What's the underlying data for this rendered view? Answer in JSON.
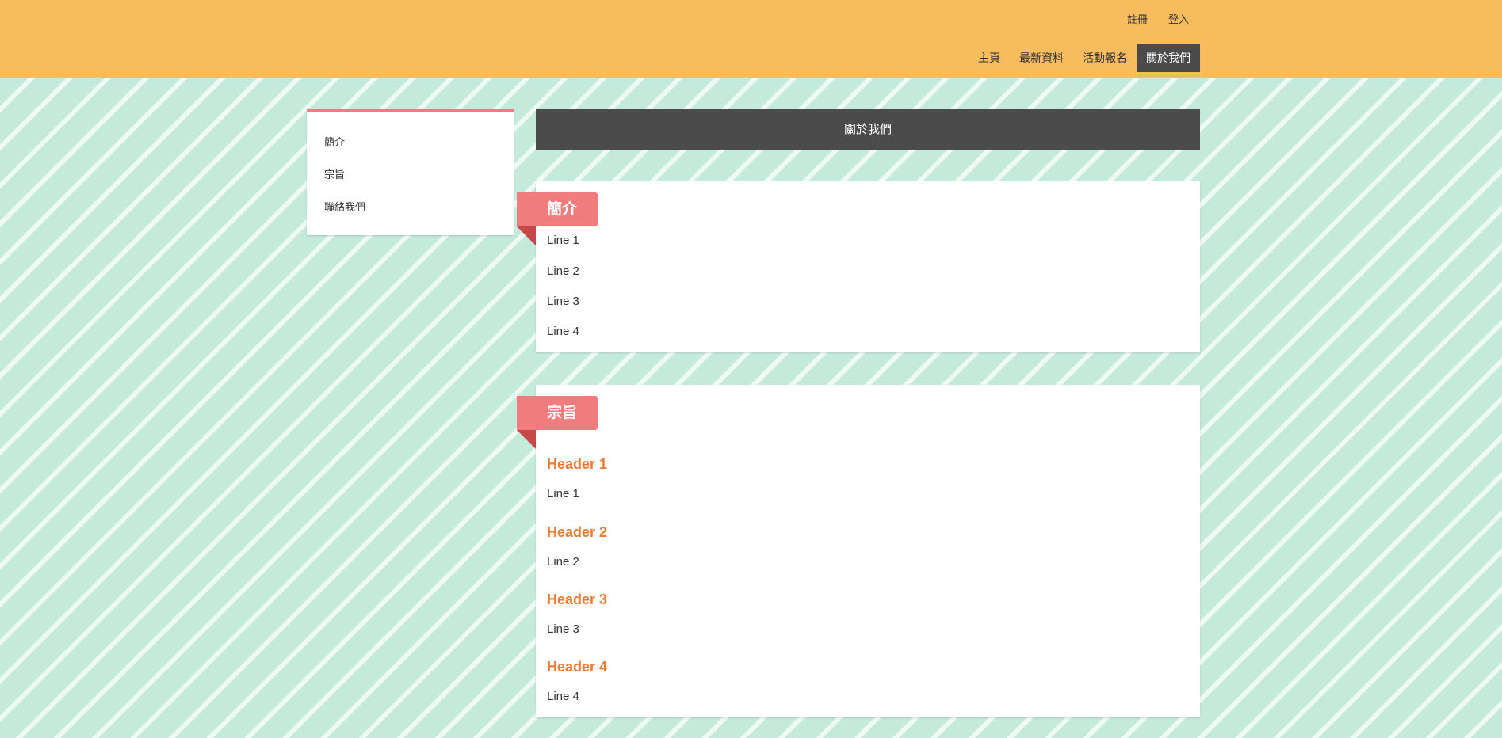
{
  "header": {
    "top_links": [
      "註冊",
      "登入"
    ],
    "nav": {
      "items": [
        "主頁",
        "最新資料",
        "活動報名",
        "關於我們"
      ],
      "active": "關於我們"
    }
  },
  "sidebar": {
    "items": [
      "簡介",
      "宗旨",
      "聯絡我們"
    ]
  },
  "page_title": "關於我們",
  "sections": [
    {
      "title": "簡介",
      "lines": [
        "Line 1",
        "Line 2",
        "Line 3",
        "Line 4"
      ]
    },
    {
      "title": "宗旨",
      "blocks": [
        {
          "header": "Header 1",
          "line": "Line 1"
        },
        {
          "header": "Header 2",
          "line": "Line 2"
        },
        {
          "header": "Header 3",
          "line": "Line 3"
        },
        {
          "header": "Header 4",
          "line": "Line 4"
        }
      ]
    }
  ],
  "colors": {
    "header_bg": "#f7bc5e",
    "page_bg": "#c4eadb",
    "stripe": "#effaf5",
    "dark": "#4b4b4b",
    "ribbon": "#f07c7d",
    "ribbon_fold": "#c64848",
    "subheader": "#f07a30"
  }
}
